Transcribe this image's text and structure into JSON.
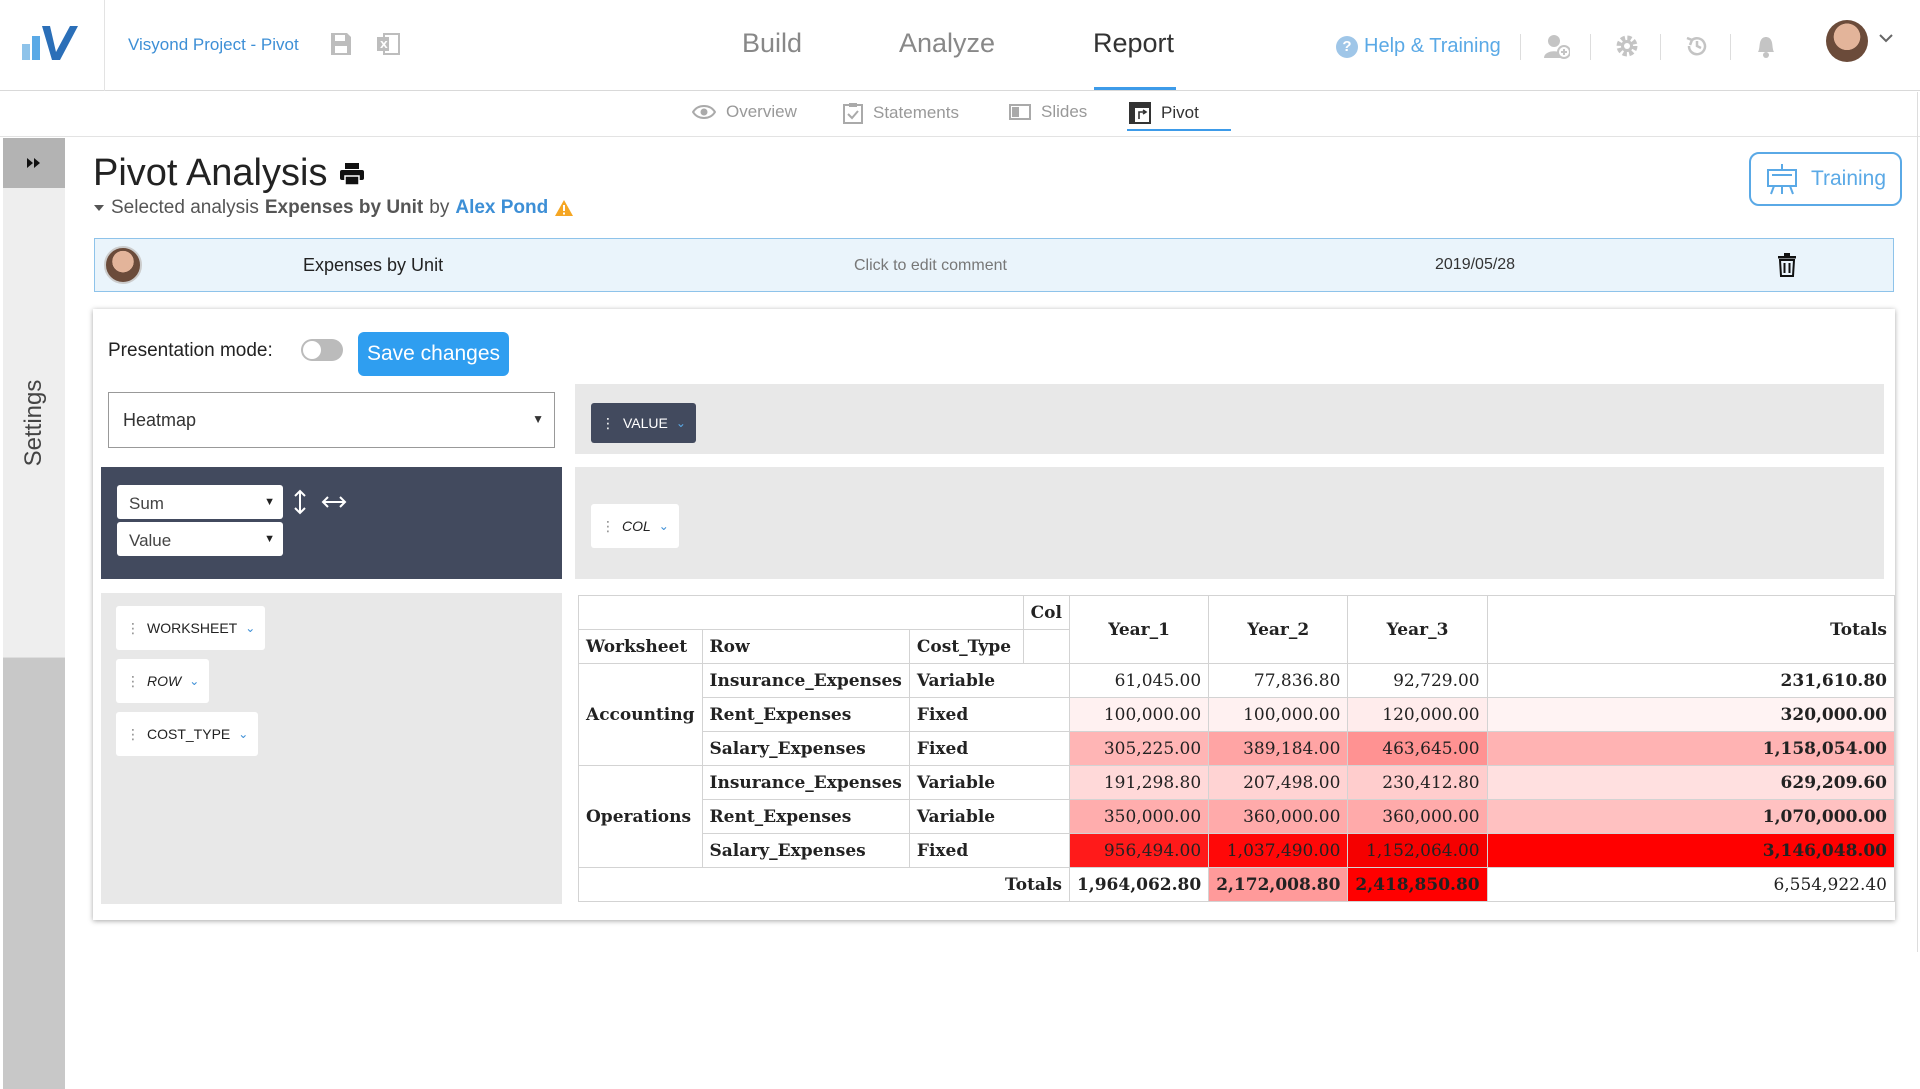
{
  "header": {
    "project_title": "Visyond Project - Pivot",
    "nav": [
      "Build",
      "Analyze",
      "Report"
    ],
    "active_nav": "Report",
    "help_label": "Help & Training"
  },
  "subnav": {
    "tabs": [
      "Overview",
      "Statements",
      "Slides",
      "Pivot"
    ],
    "active": "Pivot"
  },
  "sidebar": {
    "settings_label": "Settings"
  },
  "page": {
    "title": "Pivot Analysis",
    "selected_prefix": "Selected analysis",
    "analysis_name": "Expenses by Unit",
    "by_word": "by",
    "author": "Alex Pond",
    "training_label": "Training"
  },
  "analysis_row": {
    "name": "Expenses by Unit",
    "comment": "Click to edit comment",
    "date": "2019/05/28"
  },
  "panel": {
    "presentation_label": "Presentation mode:",
    "presentation_on": false,
    "save_label": "Save changes",
    "renderer": "Heatmap",
    "aggregator": "Sum",
    "aggregator_field": "Value",
    "value_chip": "VALUE",
    "col_chip": "COL",
    "row_chips": [
      "WORKSHEET",
      "ROW",
      "COST_TYPE"
    ]
  },
  "table": {
    "col_label": "Col",
    "row_headers": [
      "Worksheet",
      "Row",
      "Cost_Type"
    ],
    "columns": [
      "Year_1",
      "Year_2",
      "Year_3"
    ],
    "totals_label": "Totals",
    "rows": [
      {
        "worksheet": "Accounting",
        "row": "Insurance_Expenses",
        "cost": "Variable",
        "values": [
          "61,045.00",
          "77,836.80",
          "92,729.00"
        ],
        "total": "231,610.80"
      },
      {
        "worksheet": "",
        "row": "Rent_Expenses",
        "cost": "Fixed",
        "values": [
          "100,000.00",
          "100,000.00",
          "120,000.00"
        ],
        "total": "320,000.00"
      },
      {
        "worksheet": "",
        "row": "Salary_Expenses",
        "cost": "Fixed",
        "values": [
          "305,225.00",
          "389,184.00",
          "463,645.00"
        ],
        "total": "1,158,054.00"
      },
      {
        "worksheet": "Operations",
        "row": "Insurance_Expenses",
        "cost": "Variable",
        "values": [
          "191,298.80",
          "207,498.00",
          "230,412.80"
        ],
        "total": "629,209.60"
      },
      {
        "worksheet": "",
        "row": "Rent_Expenses",
        "cost": "Variable",
        "values": [
          "350,000.00",
          "360,000.00",
          "360,000.00"
        ],
        "total": "1,070,000.00"
      },
      {
        "worksheet": "",
        "row": "Salary_Expenses",
        "cost": "Fixed",
        "values": [
          "956,494.00",
          "1,037,490.00",
          "1,152,064.00"
        ],
        "total": "3,146,048.00"
      }
    ],
    "col_totals": [
      "1,964,062.80",
      "2,172,008.80",
      "2,418,850.80"
    ],
    "grand_total": "6,554,922.40",
    "heat_colors": {
      "r0": [
        "#ffffff",
        "#ffffff",
        "#ffffff",
        "#ffffff"
      ],
      "r1": [
        "#fff1f1",
        "#fff1f1",
        "#ffecec",
        "#fff3f3"
      ],
      "r2": [
        "#ffb5b5",
        "#ffa4a4",
        "#ff9292",
        "#ffb3b3"
      ],
      "r3": [
        "#ffd9d9",
        "#ffd3d3",
        "#ffcdcd",
        "#ffe0e0"
      ],
      "r4": [
        "#ffadad",
        "#ffaaaa",
        "#ffaaaa",
        "#ffc1c1"
      ],
      "r5": [
        "#ff1a1a",
        "#ff0808",
        "#f50000",
        "#ff0000"
      ],
      "tot": [
        "#ffffff",
        "#ff9a9a",
        "#ff0000",
        "#ffffff"
      ]
    }
  },
  "colors": {
    "accent": "#3d9be9",
    "save_button": "#2f9ef0",
    "dark_panel": "#424a5e",
    "link": "#3d8fd6"
  }
}
